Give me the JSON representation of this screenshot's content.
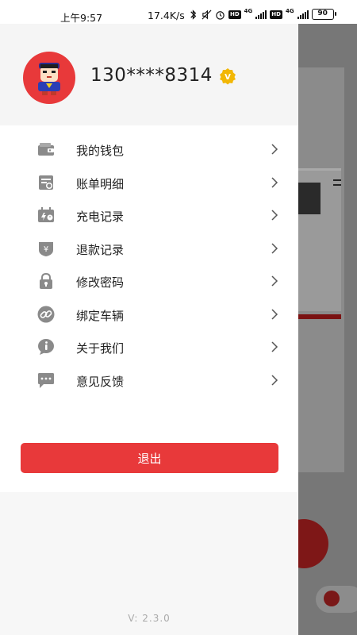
{
  "status_bar": {
    "time": "上午9:57",
    "network_speed": "17.4K/s",
    "network_type": "4G",
    "hd_label": "HD",
    "battery": "90",
    "icons": [
      "bluetooth-icon",
      "mute-icon",
      "alarm-icon",
      "hd-icon",
      "signal-icon",
      "hd-icon",
      "signal-icon",
      "battery-icon"
    ]
  },
  "profile": {
    "phone": "130****8314",
    "vip_badge": "V",
    "avatar_icon": "superhero-avatar"
  },
  "menu": {
    "items": [
      {
        "label": "我的钱包",
        "icon": "wallet-icon"
      },
      {
        "label": "账单明细",
        "icon": "bill-icon"
      },
      {
        "label": "充电记录",
        "icon": "charging-record-icon"
      },
      {
        "label": "退款记录",
        "icon": "refund-icon"
      },
      {
        "label": "修改密码",
        "icon": "lock-icon"
      },
      {
        "label": "绑定车辆",
        "icon": "link-icon"
      },
      {
        "label": "关于我们",
        "icon": "info-icon"
      },
      {
        "label": "意见反馈",
        "icon": "feedback-icon"
      }
    ]
  },
  "logout_label": "退出",
  "version": "V: 2.3.0",
  "colors": {
    "accent": "#e8393a",
    "icon_gray": "#8a8a8a",
    "badge_gold": "#f2b705",
    "overlay": "#777777"
  }
}
